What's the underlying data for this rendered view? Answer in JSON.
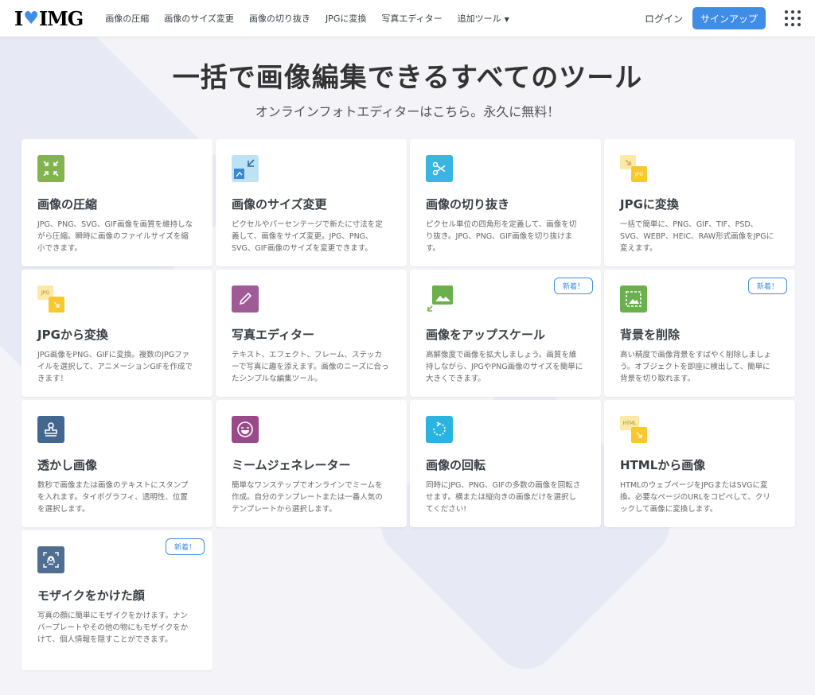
{
  "header": {
    "logo_prefix": "I",
    "logo_suffix": "IMG",
    "nav": [
      {
        "label": "画像の圧縮"
      },
      {
        "label": "画像のサイズ変更"
      },
      {
        "label": "画像の切り抜き"
      },
      {
        "label": "JPGに変換"
      },
      {
        "label": "写真エディター"
      },
      {
        "label": "追加ツール"
      }
    ],
    "login": "ログイン",
    "signup": "サインアップ"
  },
  "hero": {
    "title": "一括で画像編集できるすべてのツール",
    "subtitle": "オンラインフォトエディターはこちら。永久に無料！"
  },
  "badge_label": "新着！",
  "tools": [
    {
      "title": "画像の圧縮",
      "desc": "JPG、PNG、SVG、GIF画像を画質を維持しながら圧縮。瞬時に画像のファイルサイズを縮小できます。",
      "icon": "compress-icon"
    },
    {
      "title": "画像のサイズ変更",
      "desc": "ピクセルやパーセンテージで新たに寸法を定義して、画像をサイズ変更。JPG、PNG、SVG、GIF画像のサイズを変更できます。",
      "icon": "resize-icon"
    },
    {
      "title": "画像の切り抜き",
      "desc": "ピクセル単位の四角形を定義して、画像を切り抜き。JPG、PNG、GIF画像を切り抜けます。",
      "icon": "crop-icon"
    },
    {
      "title": "JPGに変換",
      "desc": "一括で簡単に、PNG、GIF、TIF、PSD、SVG、WEBP、HEIC、RAW形式画像をJPGに変えます。",
      "icon": "convert-to-jpg-icon"
    },
    {
      "title": "JPGから変換",
      "desc": "JPG画像をPNG、GIFに変換。複数のJPGファイルを選択して、アニメーションGIFを作成できます！",
      "icon": "convert-from-jpg-icon"
    },
    {
      "title": "写真エディター",
      "desc": "テキスト、エフェクト、フレーム、ステッカーで写真に趣を添えます。画像のニーズに合ったシンプルな編集ツール。",
      "icon": "pencil-icon"
    },
    {
      "title": "画像をアップスケール",
      "desc": "高解像度で画像を拡大しましょう。画質を維持しながら、JPGやPNG画像のサイズを簡単に大きくできます。",
      "icon": "upscale-icon",
      "badge": true
    },
    {
      "title": "背景を削除",
      "desc": "高い精度で画像背景をすばやく削除しましょう。オブジェクトを即座に検出して、簡単に背景を切り取れます。",
      "icon": "remove-background-icon",
      "badge": true
    },
    {
      "title": "透かし画像",
      "desc": "数秒で画像または画像のテキストにスタンプを入れます。タイポグラフィ、透明性、位置を選択します。",
      "icon": "stamp-icon"
    },
    {
      "title": "ミームジェネレーター",
      "desc": "簡単なワンステップでオンラインでミームを作成。自分のテンプレートまたは一番人気のテンプレートから選択します。",
      "icon": "meme-face-icon"
    },
    {
      "title": "画像の回転",
      "desc": "同時にJPG、PNG、GIFの多数の画像を回転させます。横または縦向きの画像だけを選択してください!",
      "icon": "rotate-icon"
    },
    {
      "title": "HTMLから画像",
      "desc": "HTMLのウェブページをJPGまたはSVGに変換。必要なページのURLをコピペして、クリックして画像に変換します。",
      "icon": "html-to-image-icon"
    },
    {
      "title": "モザイクをかけた顔",
      "desc": "写真の顔に簡単にモザイクをかけます。ナンバープレートやその他の物にもモザイクをかけて、個人情報を隠すことができます。",
      "icon": "blur-face-icon",
      "badge": true
    }
  ]
}
